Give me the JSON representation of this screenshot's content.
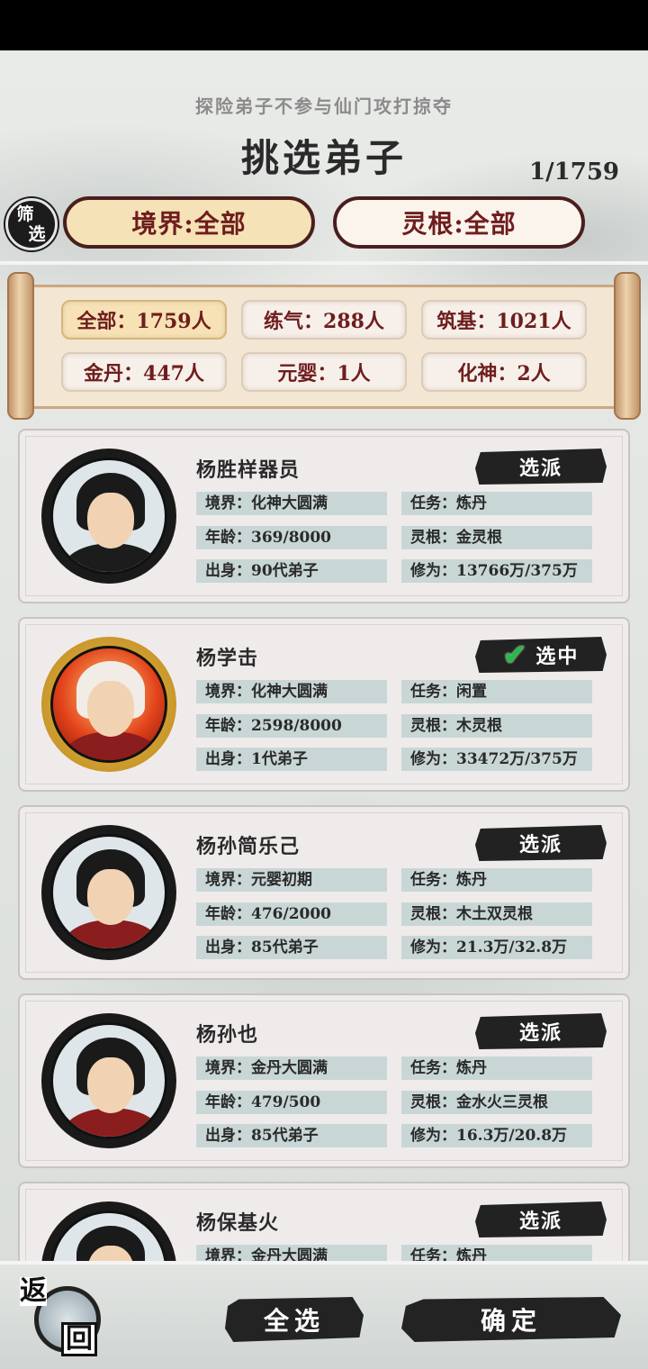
{
  "header": {
    "tip": "探险弟子不参与仙门攻打掠夺",
    "title": "挑选弟子",
    "count": "1/1759"
  },
  "filters": {
    "icon_top": "筛",
    "icon_bottom": "选",
    "realm_label": "境界:全部",
    "root_label": "灵根:全部"
  },
  "stats": [
    {
      "label": "全部：1759人",
      "active": true
    },
    {
      "label": "练气：288人",
      "active": false
    },
    {
      "label": "筑基：1021人",
      "active": false
    },
    {
      "label": "金丹：447人",
      "active": false
    },
    {
      "label": "元婴：1人",
      "active": false
    },
    {
      "label": "化神：2人",
      "active": false
    }
  ],
  "disciples": [
    {
      "name": "杨胜样器员",
      "action": "选派",
      "selected": false,
      "realm": "境界：化神大圆满",
      "task": "任务：炼丹",
      "age": "年龄：369/8000",
      "root": "灵根：金灵根",
      "origin": "出身：90代弟子",
      "cultivation": "修为：13766万/375万"
    },
    {
      "name": "杨学击",
      "action": "选中",
      "selected": true,
      "realm": "境界：化神大圆满",
      "task": "任务：闲置",
      "age": "年龄：2598/8000",
      "root": "灵根：木灵根",
      "origin": "出身：1代弟子",
      "cultivation": "修为：33472万/375万"
    },
    {
      "name": "杨孙简乐己",
      "action": "选派",
      "selected": false,
      "realm": "境界：元婴初期",
      "task": "任务：炼丹",
      "age": "年龄：476/2000",
      "root": "灵根：木土双灵根",
      "origin": "出身：85代弟子",
      "cultivation": "修为：21.3万/32.8万"
    },
    {
      "name": "杨孙也",
      "action": "选派",
      "selected": false,
      "realm": "境界：金丹大圆满",
      "task": "任务：炼丹",
      "age": "年龄：479/500",
      "root": "灵根：金水火三灵根",
      "origin": "出身：85代弟子",
      "cultivation": "修为：16.3万/20.8万"
    },
    {
      "name": "杨保基火",
      "action": "选派",
      "selected": false,
      "realm": "境界：金丹大圆满",
      "task": "任务：炼丹",
      "age": "",
      "root": "",
      "origin": "",
      "cultivation": ""
    }
  ],
  "footer": {
    "back_1": "返",
    "back_2": "回",
    "select_all": "全选",
    "confirm": "确定"
  },
  "icons": {
    "selected_check": "check-icon"
  },
  "colors": {
    "accent_text": "#6e1d1d",
    "active_filter_bg": "#f5e2b6",
    "ink_button": "#232323",
    "check": "#2db84a"
  }
}
